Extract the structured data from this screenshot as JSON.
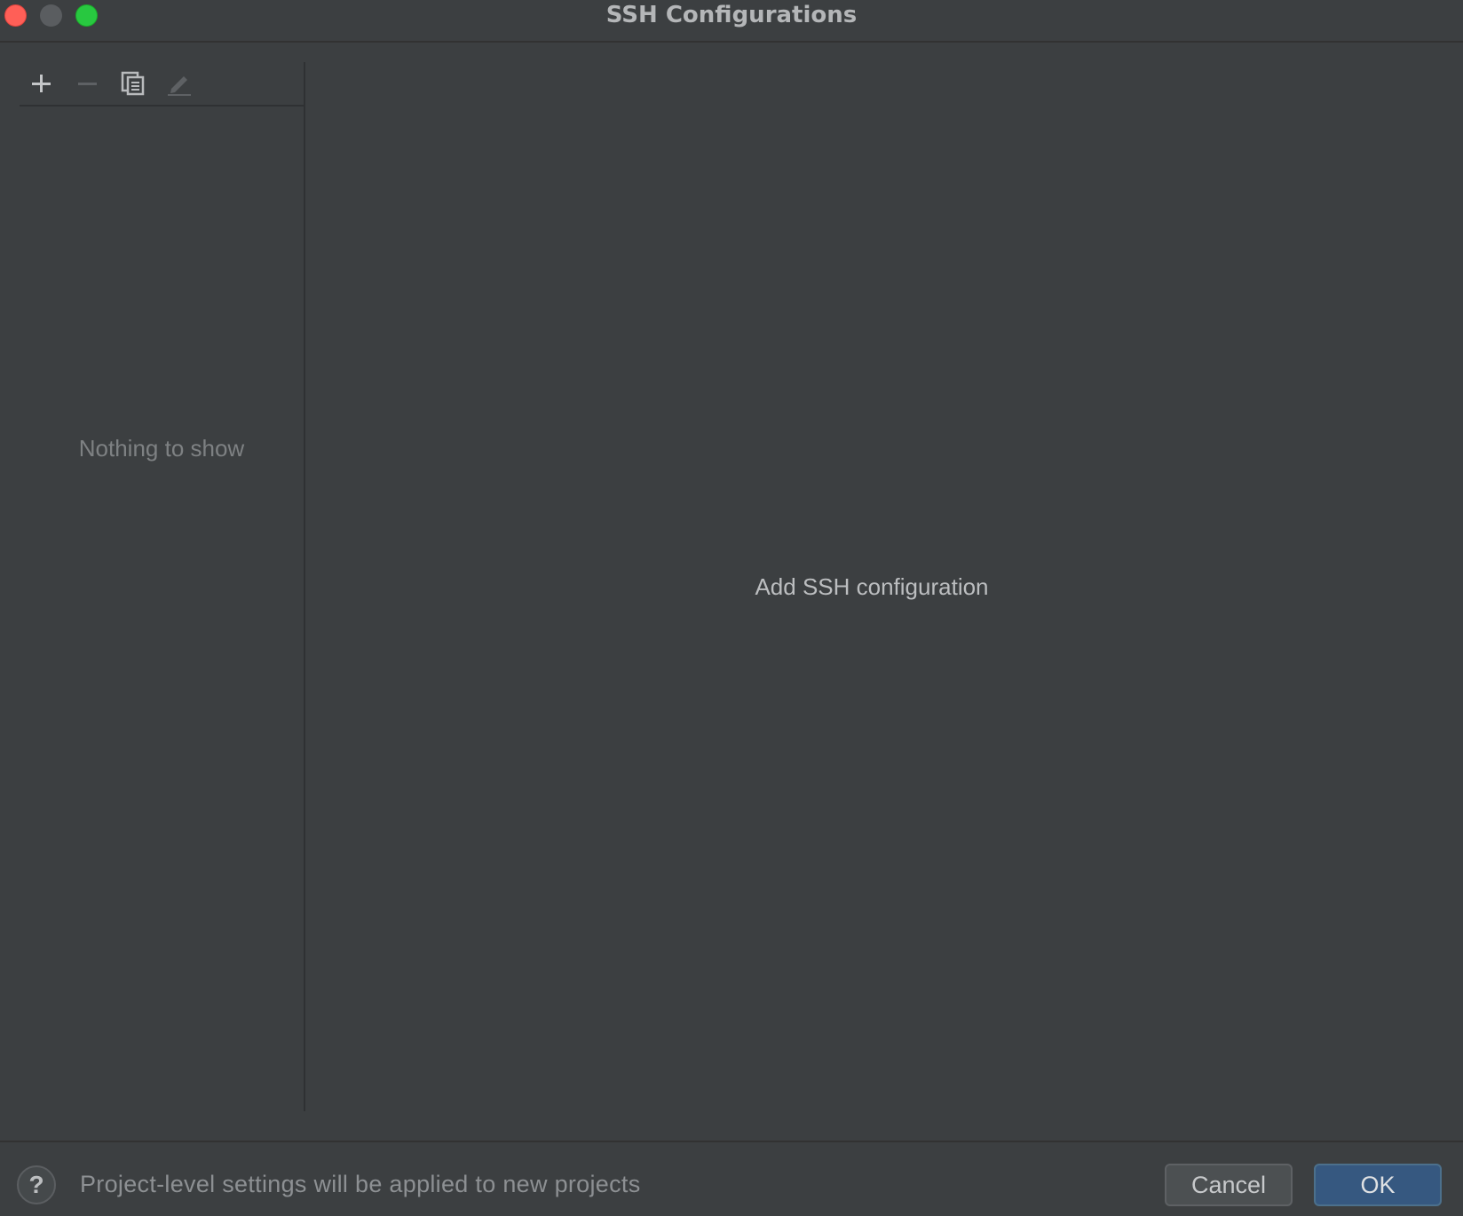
{
  "window": {
    "title": "SSH Configurations"
  },
  "toolbar": {
    "add_icon": "plus-icon",
    "remove_icon": "minus-icon",
    "copy_icon": "copy-icon",
    "edit_icon": "pencil-icon"
  },
  "list": {
    "empty_text": "Nothing to show"
  },
  "details": {
    "hint": "Add SSH configuration"
  },
  "footer": {
    "help_label": "?",
    "note": "Project-level settings will be applied to new projects",
    "cancel_label": "Cancel",
    "ok_label": "OK"
  },
  "colors": {
    "background": "#3c3f41",
    "close": "#ff5f57",
    "maximize": "#28c840",
    "ok_button": "#365880"
  }
}
